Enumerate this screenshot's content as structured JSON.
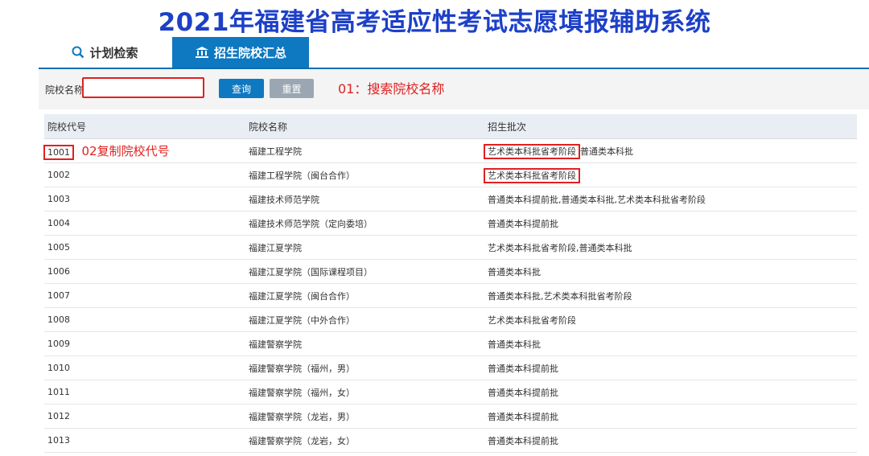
{
  "app_title": "2021年福建省高考适应性考试志愿填报辅助系统",
  "tabs": [
    {
      "label": "计划检索",
      "icon": "search-icon",
      "active": false
    },
    {
      "label": "招生院校汇总",
      "icon": "bank-icon",
      "active": true
    }
  ],
  "filter": {
    "label": "院校名称",
    "value": "",
    "placeholder": "",
    "query_label": "查询",
    "reset_label": "重置",
    "annotation": "01：搜索院校名称"
  },
  "table": {
    "columns": [
      "院校代号",
      "院校名称",
      "招生批次"
    ],
    "annotation": "02复制院校代号",
    "first_batch_highlight": "艺术类本科批省考阶段",
    "first_batch_rest": "普通类本科批",
    "rows": [
      {
        "code": "1001",
        "name": "福建工程学院",
        "batch": "艺术类本科批省考阶段,普通类本科批"
      },
      {
        "code": "1002",
        "name": "福建工程学院（闽台合作）",
        "batch": "艺术类本科批省考阶段"
      },
      {
        "code": "1003",
        "name": "福建技术师范学院",
        "batch": "普通类本科提前批,普通类本科批,艺术类本科批省考阶段"
      },
      {
        "code": "1004",
        "name": "福建技术师范学院（定向委培）",
        "batch": "普通类本科提前批"
      },
      {
        "code": "1005",
        "name": "福建江夏学院",
        "batch": "艺术类本科批省考阶段,普通类本科批"
      },
      {
        "code": "1006",
        "name": "福建江夏学院（国际课程项目）",
        "batch": "普通类本科批"
      },
      {
        "code": "1007",
        "name": "福建江夏学院（闽台合作）",
        "batch": "普通类本科批,艺术类本科批省考阶段"
      },
      {
        "code": "1008",
        "name": "福建江夏学院（中外合作）",
        "batch": "艺术类本科批省考阶段"
      },
      {
        "code": "1009",
        "name": "福建警察学院",
        "batch": "普通类本科批"
      },
      {
        "code": "1010",
        "name": "福建警察学院（福州，男）",
        "batch": "普通类本科提前批"
      },
      {
        "code": "1011",
        "name": "福建警察学院（福州，女）",
        "batch": "普通类本科提前批"
      },
      {
        "code": "1012",
        "name": "福建警察学院（龙岩，男）",
        "batch": "普通类本科提前批"
      },
      {
        "code": "1013",
        "name": "福建警察学院（龙岩，女）",
        "batch": "普通类本科提前批"
      }
    ]
  },
  "colors": {
    "title": "#1d40c8",
    "accent": "#0e78c0",
    "annotation": "#e02020",
    "reset_button": "#9aa7b3"
  }
}
